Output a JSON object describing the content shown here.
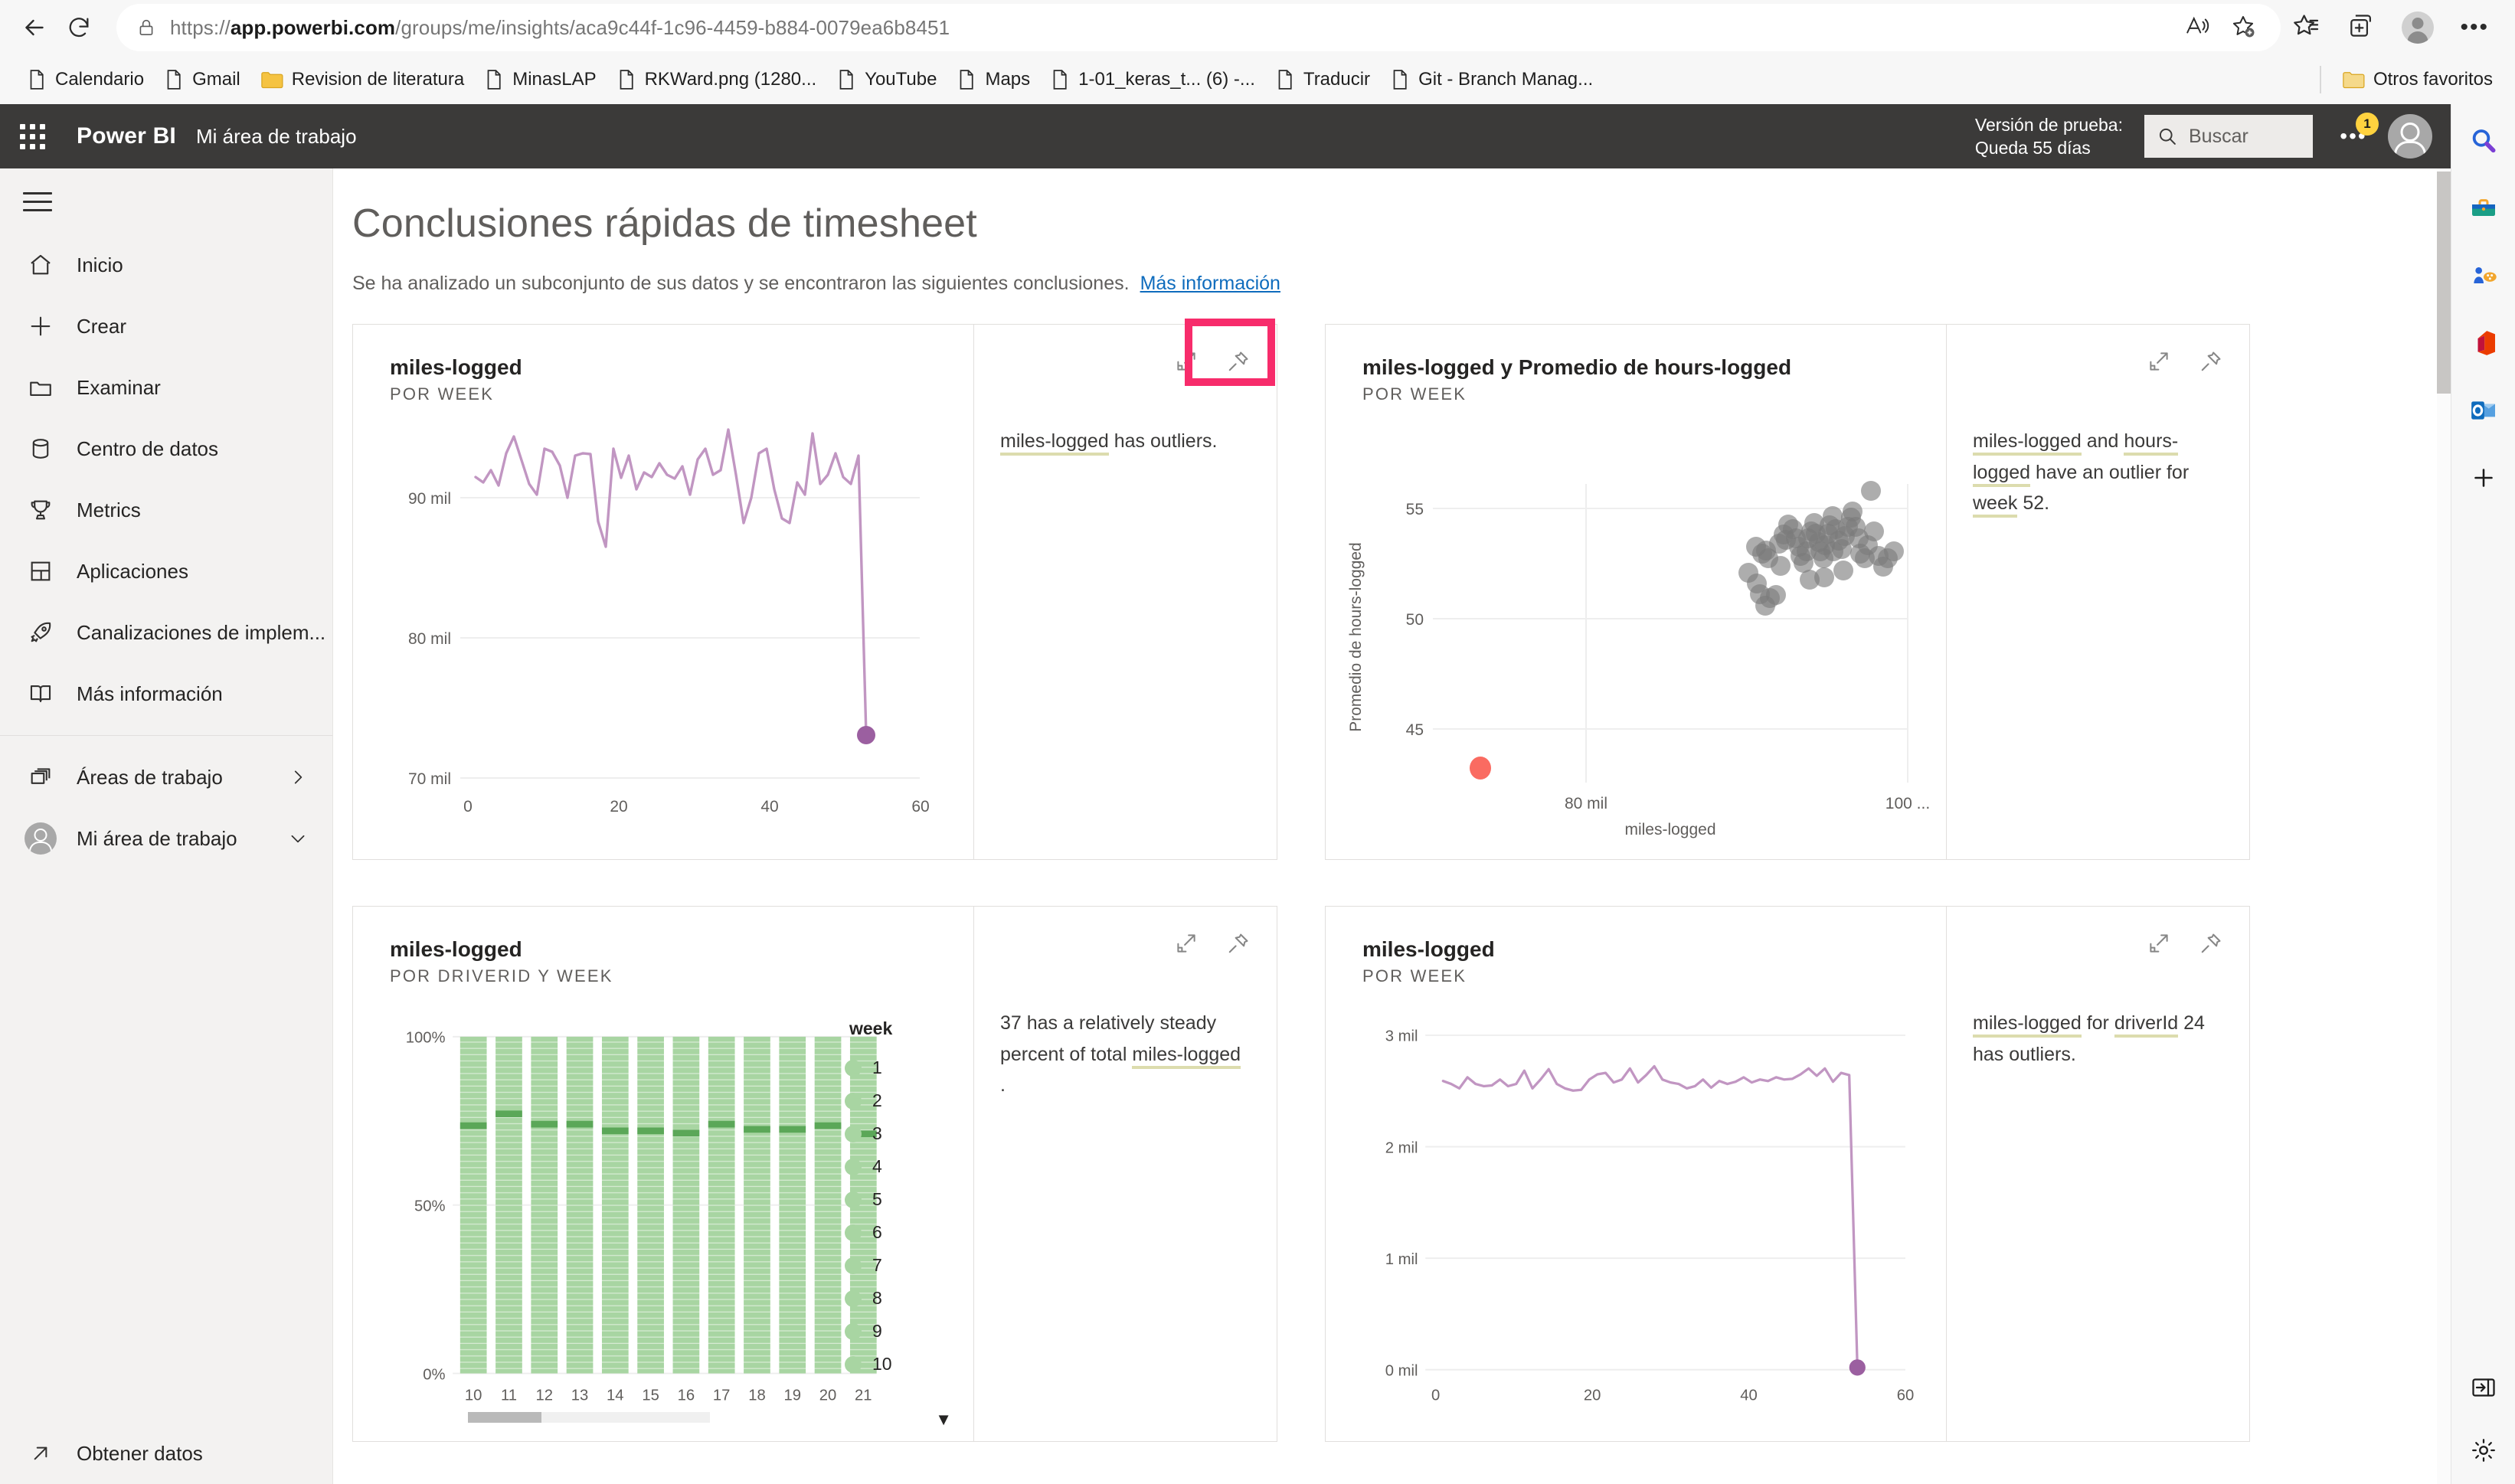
{
  "browser": {
    "url_prefix": "https://",
    "url_bold": "app.powerbi.com",
    "url_rest": "/groups/me/insights/aca9c44f-1c96-4459-b884-0079ea6b8451",
    "back_icon": "back-arrow-icon",
    "reload_icon": "reload-icon",
    "lock_icon": "lock-icon",
    "read_aloud_icon": "read-aloud-icon",
    "add_favorite_icon": "add-favorite-icon",
    "favorites_icon": "favorites-icon",
    "collections_icon": "collections-icon",
    "profile_icon": "browser-profile-icon",
    "settings_more_icon": "browser-more-icon",
    "bookmarks": [
      {
        "label": "Calendario",
        "icon": "page-icon"
      },
      {
        "label": "Gmail",
        "icon": "page-icon"
      },
      {
        "label": "Revision de literatura",
        "icon": "folder-icon"
      },
      {
        "label": "MinasLAP",
        "icon": "page-icon"
      },
      {
        "label": "RKWard.png (1280...",
        "icon": "page-icon"
      },
      {
        "label": "YouTube",
        "icon": "page-icon"
      },
      {
        "label": "Maps",
        "icon": "page-icon"
      },
      {
        "label": "1-01_keras_t... (6) -...",
        "icon": "page-icon"
      },
      {
        "label": "Traducir",
        "icon": "page-icon"
      },
      {
        "label": "Git - Branch Manag...",
        "icon": "page-icon"
      }
    ],
    "other_favorites": {
      "label": "Otros favoritos",
      "icon": "folder-icon"
    }
  },
  "pbi_header": {
    "waffle_icon": "app-launcher-icon",
    "brand": "Power BI",
    "workspace": "Mi área de trabajo",
    "trial_line1": "Versión de prueba:",
    "trial_line2": "Queda 55 días",
    "search_placeholder": "Buscar",
    "search_icon": "search-icon",
    "more_icon": "more-icon",
    "notification_count": "1",
    "avatar_icon": "user-avatar-icon"
  },
  "sidebar": {
    "hamburger_icon": "hamburger-icon",
    "items": [
      {
        "label": "Inicio",
        "icon": "home-icon"
      },
      {
        "label": "Crear",
        "icon": "plus-icon"
      },
      {
        "label": "Examinar",
        "icon": "folder-icon"
      },
      {
        "label": "Centro de datos",
        "icon": "database-icon"
      },
      {
        "label": "Metrics",
        "icon": "trophy-icon"
      },
      {
        "label": "Aplicaciones",
        "icon": "apps-grid-icon"
      },
      {
        "label": "Canalizaciones de implem...",
        "icon": "rocket-icon"
      },
      {
        "label": "Más información",
        "icon": "book-icon"
      }
    ],
    "workspaces": {
      "label": "Áreas de trabajo",
      "icon": "workspaces-icon",
      "chevron": "chevron-right-icon"
    },
    "my_workspace": {
      "label": "Mi área de trabajo",
      "icon": "user-avatar-icon",
      "chevron": "chevron-down-icon"
    },
    "get_data": {
      "label": "Obtener datos",
      "icon": "arrow-up-right-icon"
    }
  },
  "page": {
    "title": "Conclusiones rápidas de timesheet",
    "subtitle": "Se ha analizado un subconjunto de sus datos y se encontraron las siguientes conclusiones.",
    "learn_more": "Más información"
  },
  "cards": [
    {
      "title": "miles-logged",
      "subtitle": "POR WEEK",
      "focus_icon": "focus-mode-icon",
      "pin_icon": "pin-icon",
      "highlighted": true,
      "insight_parts": [
        {
          "text": "miles-logged",
          "token": true
        },
        {
          "text": " has outliers.",
          "token": false
        }
      ]
    },
    {
      "title": "miles-logged y Promedio de hours-logged",
      "subtitle": "POR WEEK",
      "focus_icon": "focus-mode-icon",
      "pin_icon": "pin-icon",
      "highlighted": false,
      "insight_parts": [
        {
          "text": "miles-logged",
          "token": true
        },
        {
          "text": " and ",
          "token": false
        },
        {
          "text": "hours-logged",
          "token": true
        },
        {
          "text": " have an outlier for ",
          "token": false
        },
        {
          "text": "week",
          "token": true
        },
        {
          "text": " 52.",
          "token": false
        }
      ]
    },
    {
      "title": "miles-logged",
      "subtitle": "POR DRIVERID Y WEEK",
      "focus_icon": "focus-mode-icon",
      "pin_icon": "pin-icon",
      "highlighted": false,
      "insight_parts": [
        {
          "text": "37 has a relatively steady percent of total ",
          "token": false
        },
        {
          "text": "miles-logged",
          "token": true
        },
        {
          "text": " .",
          "token": false
        }
      ]
    },
    {
      "title": "miles-logged",
      "subtitle": "POR WEEK",
      "focus_icon": "focus-mode-icon",
      "pin_icon": "pin-icon",
      "highlighted": false,
      "insight_parts": [
        {
          "text": "miles-logged",
          "token": true
        },
        {
          "text": " for ",
          "token": false
        },
        {
          "text": "driverId",
          "token": true
        },
        {
          "text": " 24 has outliers.",
          "token": false
        }
      ]
    }
  ],
  "colors": {
    "line_purple": "#c196c2",
    "outlier_purple": "#9b5fa0",
    "outlier_red": "#fa6b61",
    "scatter_gray": "#7a7a7a",
    "bar_green": "#a8d5a2",
    "bar_green_dark": "#5ba758",
    "highlight_pink": "#f72c6b",
    "pbi_header_bg": "#3b3a39",
    "link_blue": "#0f6cbd",
    "token_underline": "#dcdcae"
  },
  "chart_data": [
    {
      "id": "card1-line",
      "type": "line",
      "title": "miles-logged",
      "subtitle": "POR WEEK",
      "xlabel": "",
      "ylabel": "",
      "ytick_labels": [
        "70 mil",
        "80 mil",
        "90 mil"
      ],
      "ytick_values": [
        70000,
        80000,
        90000
      ],
      "xtick_labels": [
        "0",
        "20",
        "40",
        "60"
      ],
      "xtick_values": [
        0,
        20,
        40,
        60
      ],
      "xlim": [
        0,
        60
      ],
      "ylim": [
        70000,
        96000
      ],
      "grid": true,
      "series": [
        {
          "name": "miles-logged",
          "color": "#c196c2",
          "x": [
            1,
            2,
            3,
            4,
            5,
            6,
            7,
            8,
            9,
            10,
            11,
            12,
            13,
            14,
            15,
            16,
            17,
            18,
            19,
            20,
            21,
            22,
            23,
            24,
            25,
            26,
            27,
            28,
            29,
            30,
            31,
            32,
            33,
            34,
            35,
            36,
            37,
            38,
            39,
            40,
            41,
            42,
            43,
            44,
            45,
            46,
            47,
            48,
            49,
            50,
            51,
            52
          ],
          "y": [
            91500,
            91100,
            92000,
            90900,
            93200,
            94400,
            92700,
            91000,
            90200,
            93500,
            93300,
            92300,
            90000,
            93000,
            93200,
            93100,
            88300,
            86500,
            93800,
            91300,
            92900,
            90500,
            91800,
            91500,
            92500,
            91600,
            91300,
            92200,
            90200,
            92700,
            93500,
            91600,
            92000,
            94900,
            91600,
            88100,
            89900,
            93200,
            93500,
            90500,
            88600,
            88100,
            91100,
            90200,
            93700,
            91000,
            91600,
            93200,
            91500,
            91000,
            92900,
            73500
          ]
        }
      ],
      "outlier_point": {
        "x": 52,
        "y": 73500,
        "color": "#9b5fa0"
      }
    },
    {
      "id": "card2-scatter",
      "type": "scatter",
      "title": "miles-logged y Promedio de hours-logged",
      "subtitle": "POR WEEK",
      "xlabel": "miles-logged",
      "ylabel": "Promedio de hours-logged",
      "ytick_labels": [
        "45",
        "50",
        "55"
      ],
      "ytick_values": [
        45,
        50,
        55
      ],
      "xtick_labels": [
        "80 mil",
        "100 ..."
      ],
      "xtick_values": [
        80000,
        100000
      ],
      "xlim": [
        70000,
        102000
      ],
      "ylim": [
        41,
        57
      ],
      "grid": true,
      "cluster_color": "#7a7a7a",
      "outlier_color": "#fa6b61",
      "points": [
        [
          89800,
          52.1
        ],
        [
          90300,
          51.6
        ],
        [
          90500,
          51.1
        ],
        [
          90800,
          50.6
        ],
        [
          91000,
          51.4
        ],
        [
          91400,
          50.8
        ],
        [
          90200,
          53.3
        ],
        [
          90600,
          53.0
        ],
        [
          91000,
          52.8
        ],
        [
          91700,
          53.5
        ],
        [
          92000,
          53.9
        ],
        [
          92300,
          54.4
        ],
        [
          92600,
          54.2
        ],
        [
          92800,
          53.8
        ],
        [
          93000,
          53.4
        ],
        [
          93100,
          53.0
        ],
        [
          93300,
          52.7
        ],
        [
          93500,
          53.2
        ],
        [
          93600,
          53.8
        ],
        [
          93800,
          54.1
        ],
        [
          94000,
          54.5
        ],
        [
          94100,
          54.0
        ],
        [
          94300,
          53.6
        ],
        [
          94400,
          53.2
        ],
        [
          94600,
          52.9
        ],
        [
          94700,
          53.5
        ],
        [
          94900,
          54.0
        ],
        [
          95000,
          54.4
        ],
        [
          95200,
          54.8
        ],
        [
          95400,
          54.2
        ],
        [
          95600,
          53.7
        ],
        [
          95800,
          53.3
        ],
        [
          96000,
          53.9
        ],
        [
          96200,
          54.3
        ],
        [
          96400,
          54.7
        ],
        [
          96500,
          55.0
        ],
        [
          96700,
          54.3
        ],
        [
          96900,
          53.8
        ],
        [
          97000,
          53.1
        ],
        [
          97300,
          52.9
        ],
        [
          97500,
          53.5
        ],
        [
          97700,
          55.9
        ],
        [
          97900,
          54.1
        ],
        [
          98200,
          53.0
        ],
        [
          98500,
          52.5
        ],
        [
          98800,
          52.9
        ],
        [
          99200,
          53.2
        ],
        [
          93900,
          51.8
        ],
        [
          94800,
          51.9
        ],
        [
          96000,
          52.2
        ],
        [
          92100,
          52.4
        ],
        [
          91200,
          53.1
        ],
        [
          92400,
          53.6
        ],
        [
          95100,
          53.1
        ]
      ],
      "outliers": [
        [
          76500,
          41.6
        ]
      ]
    },
    {
      "id": "card3-stackedbar",
      "type": "bar",
      "title": "miles-logged",
      "subtitle": "POR DRIVERID Y WEEK",
      "xlabel": "",
      "ylabel": "",
      "stacked": true,
      "percent": true,
      "ytick_labels": [
        "0%",
        "50%",
        "100%"
      ],
      "ytick_values": [
        0,
        50,
        100
      ],
      "categories": [
        "10",
        "11",
        "12",
        "13",
        "14",
        "15",
        "16",
        "17",
        "18",
        "19",
        "20",
        "21"
      ],
      "highlight_band_pct": [
        74.5,
        78.0,
        75.0,
        75.0,
        73.0,
        73.0,
        72.5,
        75.0,
        73.5,
        73.5,
        74.5,
        72.8
      ],
      "legend_title": "week",
      "legend_items": [
        "1",
        "2",
        "3",
        "4",
        "5",
        "6",
        "7",
        "8",
        "9",
        "10"
      ],
      "legend_more_icon": "chevron-down-icon",
      "scrollbar": {
        "icon": "horizontal-scrollbar",
        "thumb_fraction": 0.3
      },
      "series_color": "#a8d5a2",
      "highlight_color": "#5ba758"
    },
    {
      "id": "card4-line",
      "type": "line",
      "title": "miles-logged",
      "subtitle": "POR WEEK",
      "xlabel": "",
      "ylabel": "",
      "ytick_labels": [
        "0 mil",
        "1 mil",
        "2 mil",
        "3 mil"
      ],
      "ytick_values": [
        0,
        1000,
        2000,
        3000
      ],
      "xtick_labels": [
        "0",
        "20",
        "40",
        "60"
      ],
      "xtick_values": [
        0,
        20,
        40,
        60
      ],
      "xlim": [
        0,
        60
      ],
      "ylim": [
        0,
        3000
      ],
      "grid": true,
      "series": [
        {
          "name": "miles-logged",
          "color": "#c196c2",
          "x": [
            1,
            2,
            3,
            4,
            5,
            6,
            7,
            8,
            9,
            10,
            11,
            12,
            13,
            14,
            15,
            16,
            17,
            18,
            19,
            20,
            21,
            22,
            23,
            24,
            25,
            26,
            27,
            28,
            29,
            30,
            31,
            32,
            33,
            34,
            35,
            36,
            37,
            38,
            39,
            40,
            41,
            42,
            43,
            44,
            45,
            46,
            47,
            48,
            49,
            50,
            51,
            52
          ],
          "y": [
            2590,
            2560,
            2520,
            2620,
            2560,
            2540,
            2550,
            2600,
            2540,
            2560,
            2680,
            2520,
            2600,
            2690,
            2560,
            2520,
            2500,
            2505,
            2600,
            2650,
            2660,
            2580,
            2600,
            2710,
            2570,
            2640,
            2720,
            2600,
            2570,
            2560,
            2520,
            2540,
            2600,
            2530,
            2590,
            2560,
            2580,
            2620,
            2570,
            2600,
            2590,
            2620,
            2600,
            2610,
            2650,
            2700,
            2630,
            2700,
            2580,
            2660,
            2640,
            20
          ]
        }
      ],
      "outlier_point": {
        "x": 52,
        "y": 20,
        "color": "#9b5fa0"
      }
    }
  ],
  "edge_rail": {
    "icons": [
      "search-icon",
      "toolbox-icon",
      "games-icon",
      "office-icon",
      "outlook-icon",
      "add-icon"
    ],
    "bottom_icons": [
      "sidebar-toggle-icon",
      "settings-gear-icon"
    ]
  }
}
